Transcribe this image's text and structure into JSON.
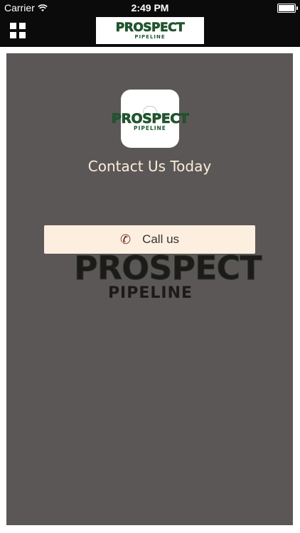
{
  "status_bar": {
    "carrier": "Carrier",
    "time": "2:49 PM"
  },
  "nav": {
    "logo_word": "PROSPECT",
    "logo_sub": "PIPELINE"
  },
  "card": {
    "icon_word": "PROSPECT",
    "icon_sub": "PIPELINE",
    "title": "Contact Us Today",
    "call_label": "Call us",
    "watermark_word": "PROSPECT",
    "watermark_sub": "PIPELINE",
    "background_color": "#5c5757",
    "button_color": "#fdefe0"
  }
}
